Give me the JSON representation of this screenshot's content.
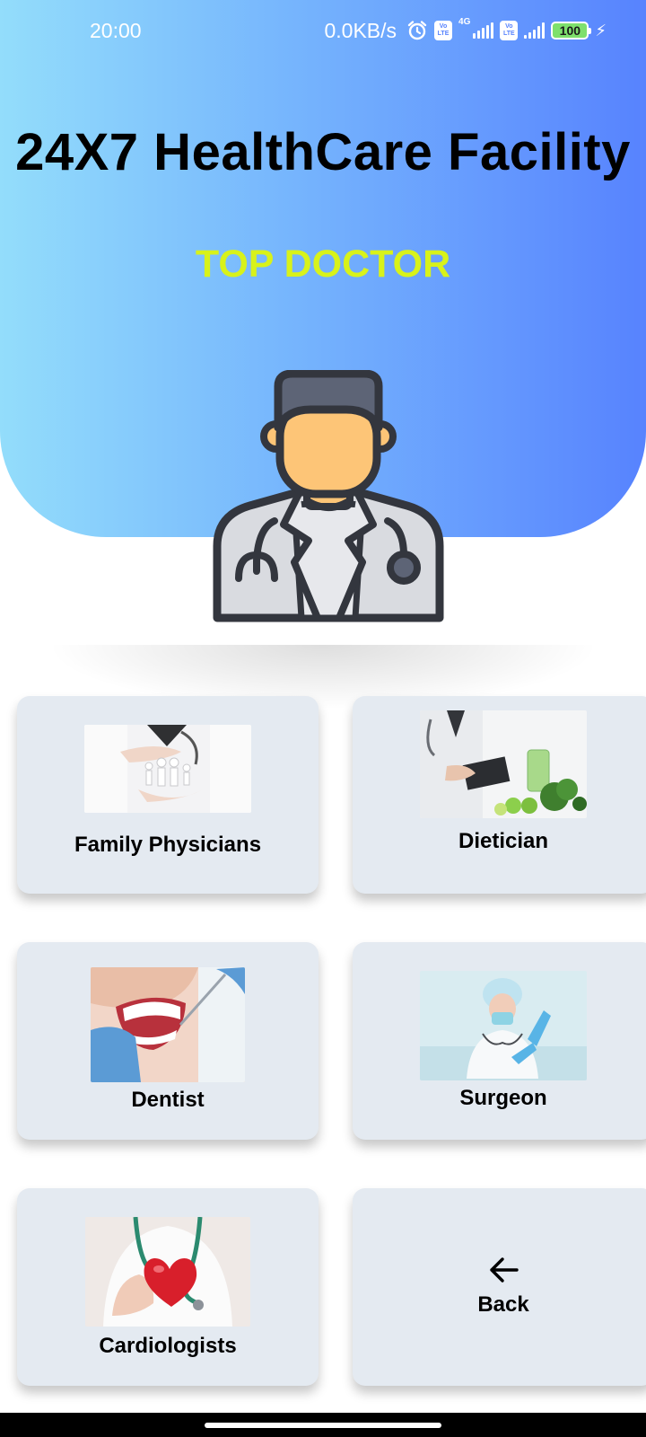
{
  "status_bar": {
    "time": "20:00",
    "network_speed": "0.0KB/s",
    "volte_label_top": "Vo",
    "volte_label_bottom": "LTE",
    "network_type": "4G",
    "battery": "100"
  },
  "header": {
    "title": "24X7 HealthCare Facility",
    "subtitle": "TOP DOCTOR",
    "title_color": "#000000",
    "subtitle_color": "#d8f21a",
    "gradient_colors": [
      "#93ddfb",
      "#5783fe"
    ]
  },
  "categories": [
    {
      "label": "Family Physicians",
      "icon": "family-care-photo"
    },
    {
      "label": "Dietician",
      "icon": "dietician-photo"
    },
    {
      "label": "Dentist",
      "icon": "dentist-photo"
    },
    {
      "label": "Surgeon",
      "icon": "surgeon-photo"
    },
    {
      "label": "Cardiologists",
      "icon": "cardiologist-photo"
    }
  ],
  "back": {
    "label": "Back",
    "icon": "arrow-left-icon"
  },
  "colors": {
    "card_bg": "#e4eaf1",
    "accent": "#5783fe"
  }
}
